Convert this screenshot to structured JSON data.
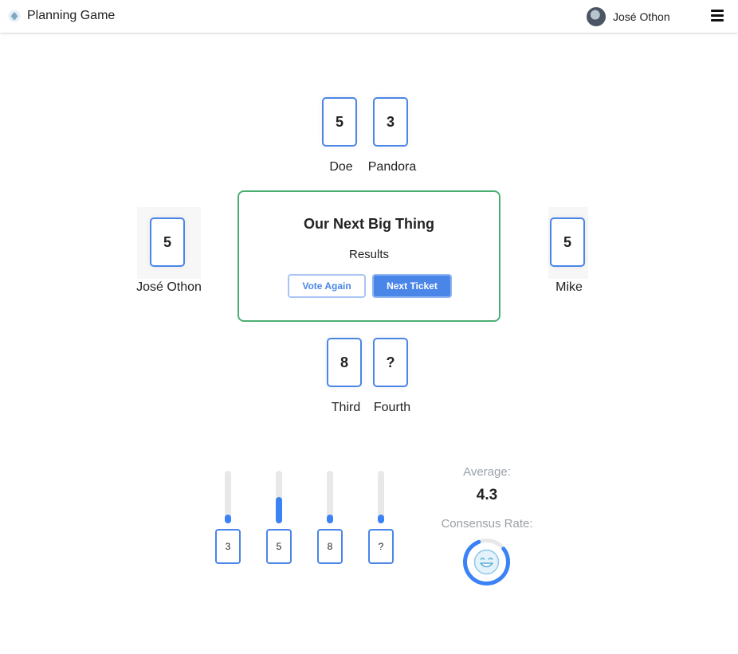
{
  "header": {
    "app_title": "Planning Game",
    "logo_icon": "spade-logo-icon",
    "user_name": "José Othon",
    "menu_icon": "hamburger-menu-icon"
  },
  "players": [
    {
      "name": "Doe",
      "card": "5"
    },
    {
      "name": "Pandora",
      "card": "3"
    },
    {
      "name": "José Othon",
      "card": "5"
    },
    {
      "name": "Mike",
      "card": "5"
    },
    {
      "name": "Third",
      "card": "8"
    },
    {
      "name": "Fourth",
      "card": "?"
    }
  ],
  "table": {
    "title": "Our Next Big Thing",
    "status": "Results",
    "vote_again_label": "Vote Again",
    "next_ticket_label": "Next Ticket"
  },
  "results": {
    "distribution": [
      {
        "card": "3",
        "votes": 1
      },
      {
        "card": "5",
        "votes": 3
      },
      {
        "card": "8",
        "votes": 1
      },
      {
        "card": "?",
        "votes": 1
      }
    ],
    "average_label": "Average:",
    "average_value": "4.3",
    "consensus_label": "Consensus Rate:",
    "consensus_icon": "smiling-face-icon"
  },
  "colors": {
    "accent": "#4a86e8",
    "table_border": "#4caf72",
    "muted_text": "#9aa0a6"
  }
}
